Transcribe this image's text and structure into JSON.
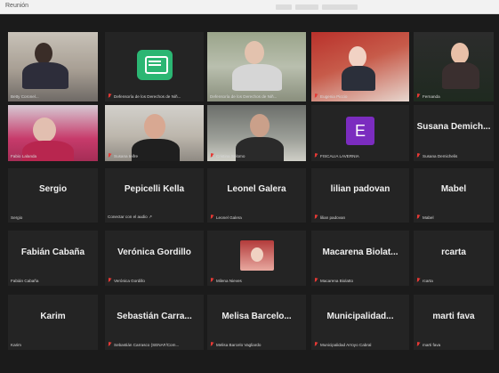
{
  "window": {
    "title": "Reunión"
  },
  "tiles": [
    {
      "id": "t1",
      "name": "Betty Coronel...",
      "muted": false,
      "kind": "video",
      "active": false
    },
    {
      "id": "t2",
      "name": "Defensoría de los Derechos de Niñ...",
      "muted": true,
      "kind": "logo",
      "active": false
    },
    {
      "id": "t3",
      "name": "Defensoría de los Derechos de Niñ...",
      "muted": false,
      "kind": "video",
      "active": true
    },
    {
      "id": "t4",
      "name": "Eugenia Piccio",
      "muted": true,
      "kind": "video",
      "active": false
    },
    {
      "id": "t5",
      "name": "Fernanda",
      "muted": true,
      "kind": "video",
      "active": false
    },
    {
      "id": "t6",
      "name": "Fabio Lalanda",
      "muted": false,
      "kind": "video",
      "active": false
    },
    {
      "id": "t7",
      "name": "Susana Ieifre",
      "muted": true,
      "kind": "video",
      "active": false
    },
    {
      "id": "t8",
      "name": "Cristina Solomo",
      "muted": true,
      "kind": "video",
      "active": false
    },
    {
      "id": "t9",
      "name": "FISCALIA LAVERNIA",
      "muted": true,
      "kind": "letter",
      "letter": "E",
      "active": false
    },
    {
      "id": "t10",
      "name": "Susana Demichelis",
      "display": "Susana Demich...",
      "muted": true,
      "kind": "name",
      "active": false
    },
    {
      "id": "t11",
      "name": "Sergio",
      "display": "Sergio",
      "muted": false,
      "kind": "name",
      "active": false
    },
    {
      "id": "t12",
      "name": "Conectar con el audio ↗",
      "display": "Pepicelli Kella",
      "muted": false,
      "kind": "name",
      "active": false
    },
    {
      "id": "t13",
      "name": "Leonel Galera",
      "display": "Leonel Galera",
      "muted": true,
      "kind": "name",
      "active": false
    },
    {
      "id": "t14",
      "name": "lilian padovan",
      "display": "lilian padovan",
      "muted": true,
      "kind": "name",
      "active": false
    },
    {
      "id": "t15",
      "name": "Mabel",
      "display": "Mabel",
      "muted": true,
      "kind": "name",
      "active": false
    },
    {
      "id": "t16",
      "name": "Fabián Cabaña",
      "display": "Fabián Cabaña",
      "muted": false,
      "kind": "name",
      "active": false
    },
    {
      "id": "t17",
      "name": "Verónica Gordillo",
      "display": "Verónica Gordillo",
      "muted": true,
      "kind": "name",
      "active": false
    },
    {
      "id": "t18",
      "name": "Milena Nieves",
      "muted": true,
      "kind": "photo",
      "active": false
    },
    {
      "id": "t19",
      "name": "Macarena Biolatto",
      "display": "Macarena  Biolat...",
      "muted": true,
      "kind": "name",
      "active": false
    },
    {
      "id": "t20",
      "name": "rcarta",
      "display": "rcarta",
      "muted": true,
      "kind": "name",
      "active": false
    },
    {
      "id": "t21",
      "name": "Karim",
      "display": "Karim",
      "muted": false,
      "kind": "name",
      "active": false
    },
    {
      "id": "t22",
      "name": "Sebastián Carrasco (SENAF/Com...",
      "display": "Sebastián  Carra...",
      "muted": true,
      "kind": "name",
      "active": false
    },
    {
      "id": "t23",
      "name": "Melisa Barcelo Vagliardo",
      "display": "Melisa  Barcelo...",
      "muted": true,
      "kind": "name",
      "active": false
    },
    {
      "id": "t24",
      "name": "Municipalidad Arroyo Cabral",
      "display": "Municipalidad...",
      "muted": true,
      "kind": "name",
      "active": false
    },
    {
      "id": "t25",
      "name": "marti fava",
      "display": "marti fava",
      "muted": true,
      "kind": "name",
      "active": false
    }
  ],
  "colors": {
    "active_border": "#d4e157",
    "muted": "#e53935",
    "tile_bg": "#242424"
  }
}
